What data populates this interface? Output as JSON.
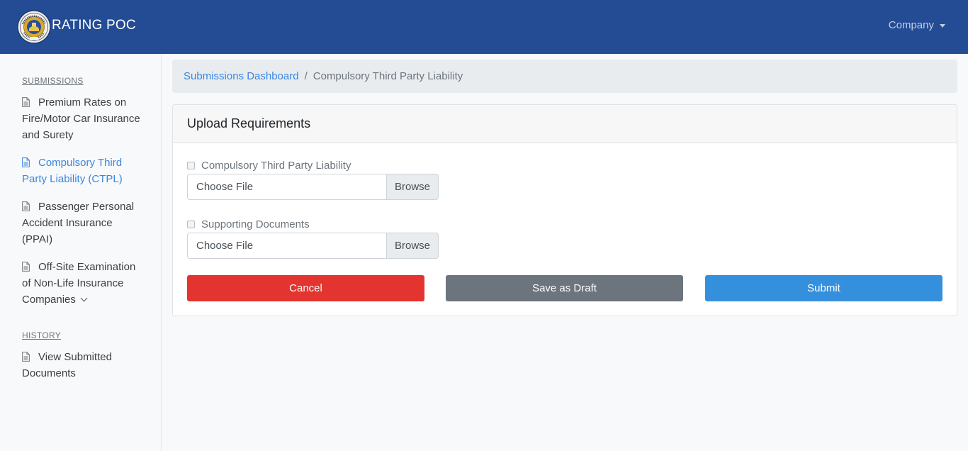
{
  "app": {
    "title": "RATING POC",
    "user_menu_label": "Company"
  },
  "sidebar": {
    "sections": [
      {
        "heading": "SUBMISSIONS",
        "items": [
          {
            "label": "Premium Rates on Fire/Motor Car Insurance and Surety",
            "active": false,
            "icon": "document-icon"
          },
          {
            "label": "Compulsory Third Party Liability (CTPL)",
            "active": true,
            "icon": "document-icon"
          },
          {
            "label": "Passenger Personal Accident Insurance (PPAI)",
            "active": false,
            "icon": "document-icon"
          },
          {
            "label": "Off-Site Examination of Non-Life Insurance Companies",
            "active": false,
            "icon": "document-icon",
            "has_submenu": true
          }
        ]
      },
      {
        "heading": "HISTORY",
        "items": [
          {
            "label": "View Submitted Documents",
            "active": false,
            "icon": "document-icon"
          }
        ]
      }
    ]
  },
  "breadcrumb": {
    "parent": "Submissions Dashboard",
    "separator": "/",
    "current": "Compulsory Third Party Liability"
  },
  "card": {
    "title": "Upload Requirements",
    "uploads": [
      {
        "label": "Compulsory Third Party Liability",
        "checked": false,
        "placeholder": "Choose File",
        "browse_label": "Browse"
      },
      {
        "label": "Supporting Documents",
        "checked": false,
        "placeholder": "Choose File",
        "browse_label": "Browse"
      }
    ],
    "actions": {
      "cancel_label": "Cancel",
      "draft_label": "Save as Draft",
      "submit_label": "Submit"
    }
  },
  "colors": {
    "navbar": "#234c94",
    "link": "#3a86e0",
    "cancel": "#e3342f",
    "draft": "#6c757d",
    "submit": "#3490dc"
  }
}
